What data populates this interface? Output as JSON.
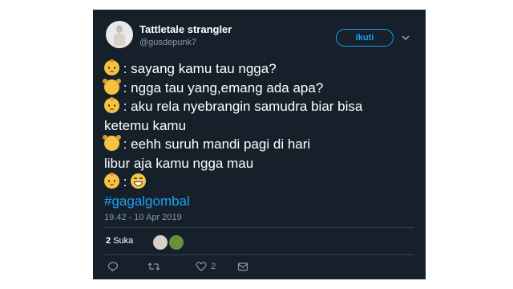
{
  "tweet": {
    "author": {
      "display_name": "Tattletale strangler",
      "handle": "@gusdepunk7"
    },
    "follow_label": "Ikuti",
    "lines": [
      ": sayang kamu tau ngga?",
      ": ngga tau yang,emang ada apa?",
      ": aku rela nyebrangin samudra biar bisa",
      "ketemu kamu",
      ": eehh",
      "suruh mandi pagi di hari",
      "libur aja kamu ngga mau",
      ":"
    ],
    "hashtag": "#gagalgombal",
    "timestamp": "19.42 - 10 Apr 2019",
    "likes": {
      "count": "2",
      "label": "Suka"
    },
    "actions": {
      "like_count": "2"
    }
  },
  "colors": {
    "background": "#15202b",
    "accent": "#1da1f2",
    "muted": "#8899a6",
    "divider": "#38444d"
  },
  "icons": [
    "baby-emoji",
    "girl-emoji",
    "grinning-emoji",
    "chevron-down-icon",
    "reply-icon",
    "retweet-icon",
    "heart-icon",
    "direct-message-icon"
  ]
}
